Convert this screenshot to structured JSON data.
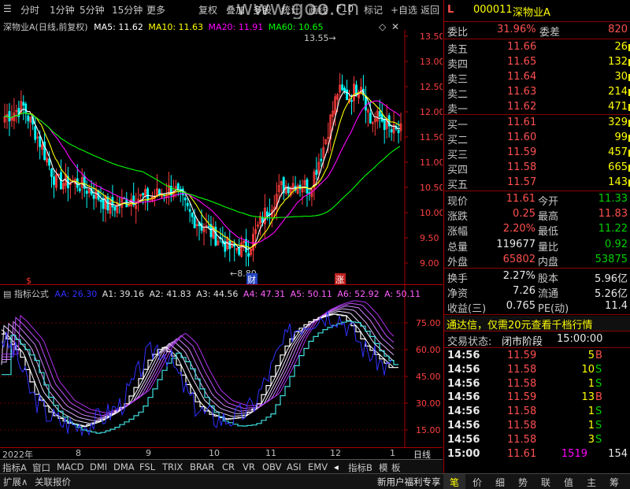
{
  "toolbar": {
    "items": [
      "分时",
      "1分钟",
      "5分钟",
      "15分钟",
      "更多",
      "复权",
      "叠加",
      "多股",
      "统计",
      "画线",
      "F10",
      "标记",
      "+自选",
      "返回"
    ],
    "watermark": "www.goo.cn"
  },
  "main_legend": {
    "stock": "深物业A(日线,前复权)",
    "ma5": "MA5: 11.62",
    "ma10": "MA10: 11.63",
    "ma20": "MA20: 11.91",
    "ma60": "MA60: 10.65"
  },
  "main_axis": [
    "13.50",
    "13.00",
    "12.50",
    "12.00",
    "11.50",
    "11.00",
    "10.50",
    "10.00",
    "9.50",
    "9.00"
  ],
  "high_label": "13.55",
  "low_label": "8.80",
  "event_marks": [
    "$",
    "财",
    "涨"
  ],
  "indicator_legend": {
    "name": "指标公式",
    "aa": "AA: 26.30",
    "a1": "A1: 39.16",
    "a2": "A2: 41.83",
    "a3": "A3: 44.56",
    "a4": "A4: 47.31",
    "a5": "A5: 50.11",
    "a6": "A6: 52.92",
    "a": "A: 50.11"
  },
  "ind_axis": [
    "75.00",
    "60.00",
    "45.00",
    "30.00",
    "15.00"
  ],
  "xaxis": {
    "labels": [
      "2022年",
      "8",
      "9",
      "10",
      "11",
      "12",
      "1"
    ],
    "period": "日线"
  },
  "tabs": [
    "指标A",
    "窗口",
    "MACD",
    "DMI",
    "DMA",
    "FSL",
    "TRIX",
    "BRAR",
    "CR",
    "VR",
    "OBV",
    "ASI",
    "EMV",
    "指标B",
    "模",
    "板"
  ],
  "statusbar": {
    "left1": "扩展∧",
    "left2": "关联报价",
    "promo": "新用户福利专享",
    "quick": [
      "笔",
      "价",
      "细",
      "势",
      "联",
      "值",
      "主",
      "筹"
    ]
  },
  "quote": {
    "code": "000011",
    "name": "深物业A",
    "level": "L",
    "weibi_label": "委比",
    "weibi": "31.96%",
    "weicha_label": "委差",
    "weicha": "820",
    "asks": [
      {
        "label": "卖五",
        "price": "11.66",
        "vol": "26"
      },
      {
        "label": "卖四",
        "price": "11.65",
        "vol": "132"
      },
      {
        "label": "卖三",
        "price": "11.64",
        "vol": "30"
      },
      {
        "label": "卖二",
        "price": "11.63",
        "vol": "214"
      },
      {
        "label": "卖一",
        "price": "11.62",
        "vol": "471"
      }
    ],
    "bids": [
      {
        "label": "买一",
        "price": "11.61",
        "vol": "329"
      },
      {
        "label": "买二",
        "price": "11.60",
        "vol": "99"
      },
      {
        "label": "买三",
        "price": "11.59",
        "vol": "457"
      },
      {
        "label": "买四",
        "price": "11.58",
        "vol": "665"
      },
      {
        "label": "买五",
        "price": "11.57",
        "vol": "143"
      }
    ],
    "stats": [
      {
        "l1": "现价",
        "v1": "11.61",
        "c1": "red",
        "l2": "今开",
        "v2": "11.33",
        "c2": "green"
      },
      {
        "l1": "涨跌",
        "v1": "0.25",
        "c1": "red",
        "l2": "最高",
        "v2": "11.83",
        "c2": "red"
      },
      {
        "l1": "涨幅",
        "v1": "2.20%",
        "c1": "red",
        "l2": "最低",
        "v2": "11.22",
        "c2": "green"
      },
      {
        "l1": "总量",
        "v1": "119677",
        "c1": "white",
        "l2": "量比",
        "v2": "0.92",
        "c2": "green"
      },
      {
        "l1": "外盘",
        "v1": "65802",
        "c1": "red",
        "l2": "内盘",
        "v2": "53875",
        "c2": "green"
      }
    ],
    "stats2": [
      {
        "l1": "换手",
        "v1": "2.27%",
        "l2": "股本",
        "v2": "5.96亿"
      },
      {
        "l1": "净资",
        "v1": "7.26",
        "l2": "流通",
        "v2": "5.26亿"
      },
      {
        "l1": "收益(三)",
        "v1": "0.765",
        "l2": "PE(动)",
        "v2": "11.4"
      }
    ],
    "promo": "通达信，仅需20元查看千档行情",
    "trade_state_label": "交易状态:",
    "trade_state": "闭市阶段",
    "trade_time": "15:00:00",
    "ticks": [
      {
        "t": "14:56",
        "p": "11.59",
        "v": "5",
        "s": "B"
      },
      {
        "t": "14:56",
        "p": "11.58",
        "v": "10",
        "s": "S"
      },
      {
        "t": "14:56",
        "p": "11.58",
        "v": "1",
        "s": "S"
      },
      {
        "t": "14:56",
        "p": "11.59",
        "v": "13",
        "s": "B"
      },
      {
        "t": "14:56",
        "p": "11.58",
        "v": "1",
        "s": "S"
      },
      {
        "t": "14:56",
        "p": "11.58",
        "v": "1",
        "s": "S"
      },
      {
        "t": "14:56",
        "p": "11.58",
        "v": "3",
        "s": "S"
      },
      {
        "t": "15:00",
        "p": "11.61",
        "v": "1519",
        "s": "154"
      }
    ]
  },
  "colors": {
    "up": "#ff3c3c",
    "down": "#00ffff",
    "ma5": "#ffffff",
    "ma10": "#ffff00",
    "ma20": "#ff00ff",
    "ma60": "#00ff00",
    "aa": "#3030ff"
  }
}
